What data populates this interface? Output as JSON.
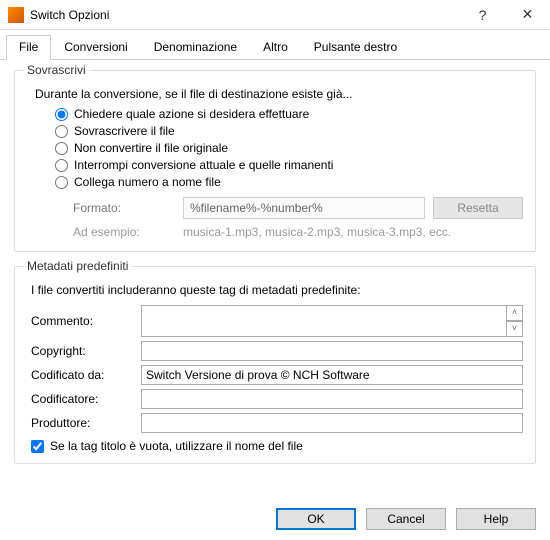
{
  "window": {
    "title": "Switch Opzioni"
  },
  "tabs": [
    "File",
    "Conversioni",
    "Denominazione",
    "Altro",
    "Pulsante destro"
  ],
  "active_tab_index": 0,
  "overwrite": {
    "legend": "Sovrascrivi",
    "intro": "Durante la conversione, se il file di destinazione esiste già...",
    "options": [
      "Chiedere quale azione si desidera effettuare",
      "Sovrascrivere il file",
      "Non convertire il file originale",
      "Interrompi conversione attuale e quelle rimanenti",
      "Collega numero a nome file"
    ],
    "selected_index": 0,
    "format_label": "Formato:",
    "format_value": "%filename%-%number%",
    "reset_button": "Resetta",
    "example_label": "Ad esempio:",
    "example_value": "musica-1.mp3, musica-2.mp3, musica-3.mp3, ecc."
  },
  "metadata": {
    "legend": "Metadati predefiniti",
    "intro": "I file convertiti includeranno queste tag di metadati predefinite:",
    "comment_label": "Commento:",
    "comment_value": "",
    "copyright_label": "Copyright:",
    "copyright_value": "",
    "encoded_by_label": "Codificato da:",
    "encoded_by_value": "Switch Versione di prova © NCH Software",
    "encoder_label": "Codificatore:",
    "encoder_value": "",
    "producer_label": "Produttore:",
    "producer_value": "",
    "title_checkbox_label": "Se la tag titolo è vuota, utilizzare il nome del file",
    "title_checkbox_checked": true
  },
  "footer": {
    "ok": "OK",
    "cancel": "Cancel",
    "help": "Help"
  }
}
